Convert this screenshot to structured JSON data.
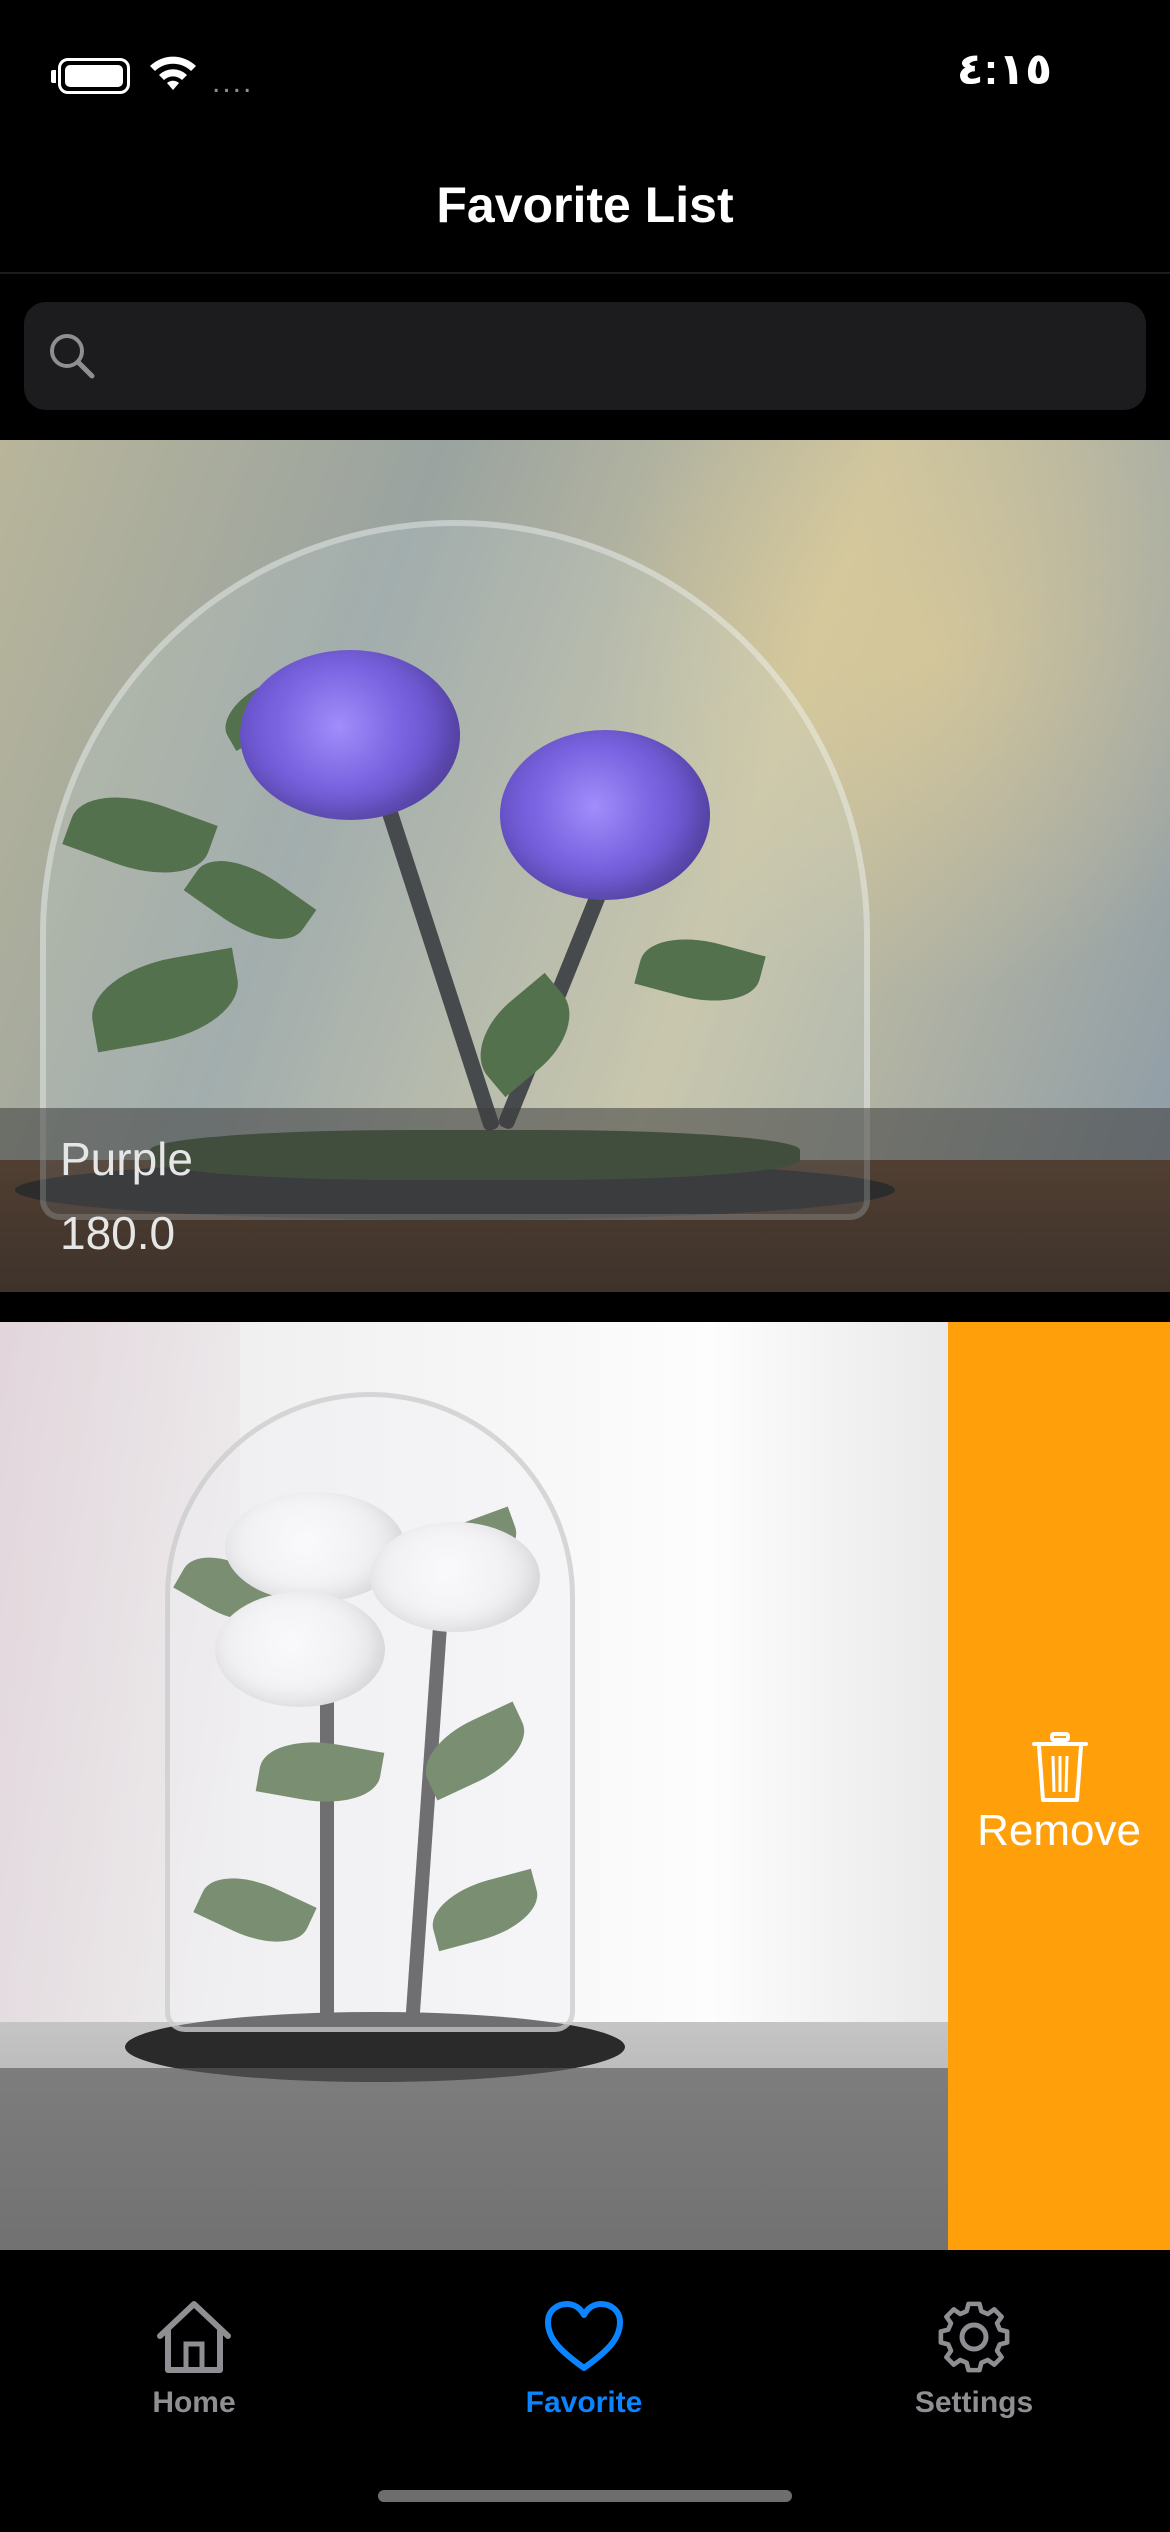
{
  "status_bar": {
    "time": "٤:١٥",
    "signal_dots": "....",
    "icons": [
      "battery-icon",
      "wifi-icon"
    ]
  },
  "nav": {
    "title": "Favorite List"
  },
  "search": {
    "placeholder": "",
    "value": ""
  },
  "favorites": [
    {
      "name": "Purple",
      "price": "180.0",
      "image": "purple-roses-in-glass-dome"
    },
    {
      "name": "",
      "price": "",
      "image": "white-roses-in-glass-dome",
      "swipe_action": "Remove"
    }
  ],
  "swipe_action": {
    "label": "Remove",
    "icon": "trash-icon",
    "color": "#ff9f0a"
  },
  "tab_bar": {
    "tabs": [
      {
        "label": "Home",
        "icon": "home-icon",
        "active": false
      },
      {
        "label": "Favorite",
        "icon": "heart-icon",
        "active": true
      },
      {
        "label": "Settings",
        "icon": "gear-icon",
        "active": false
      }
    ],
    "active_color": "#0a84ff",
    "inactive_color": "#8e8e93"
  }
}
